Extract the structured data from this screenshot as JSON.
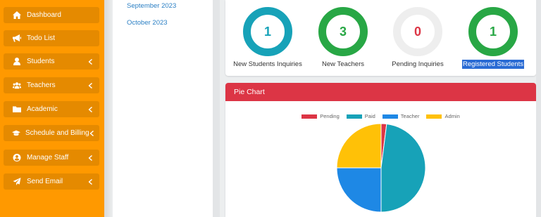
{
  "sidebar": {
    "items": [
      {
        "label": "Dashboard",
        "icon": "home-icon",
        "has_chevron": false
      },
      {
        "label": "Todo List",
        "icon": "bullhorn-icon",
        "has_chevron": false
      },
      {
        "label": "Students",
        "icon": "user-icon",
        "has_chevron": true
      },
      {
        "label": "Teachers",
        "icon": "users-icon",
        "has_chevron": true
      },
      {
        "label": "Academic",
        "icon": "folder-icon",
        "has_chevron": true
      },
      {
        "label": "Schedule and Billing",
        "icon": "graduation-cap-icon",
        "has_chevron": true
      },
      {
        "label": "Manage Staff",
        "icon": "user-circle-icon",
        "has_chevron": true
      },
      {
        "label": "Send Email",
        "icon": "paper-plane-icon",
        "has_chevron": true
      }
    ]
  },
  "months": [
    "September 2023",
    "October 2023"
  ],
  "stats": [
    {
      "value": "1",
      "label": "New Students Inquiries",
      "ring_color": "#17a2b8",
      "value_color": "#17a2b8"
    },
    {
      "value": "3",
      "label": "New Teachers",
      "ring_color": "#28a745",
      "value_color": "#28a745"
    },
    {
      "value": "0",
      "label": "Pending Inquiries",
      "ring_color": "#eeeeee",
      "value_color": "#dc3545"
    },
    {
      "value": "1",
      "label": "Registered Students",
      "ring_color": "#28a745",
      "value_color": "#28a745"
    }
  ],
  "pie_card": {
    "title": "Pie Chart"
  },
  "chart_data": {
    "type": "pie",
    "legend_position": "top",
    "categories": [
      "Pending",
      "Paid",
      "Teacher",
      "Admin"
    ],
    "values": [
      2,
      48,
      25,
      25
    ],
    "colors": [
      "#dc3545",
      "#17a2b8",
      "#1e88e5",
      "#ffc107"
    ]
  }
}
